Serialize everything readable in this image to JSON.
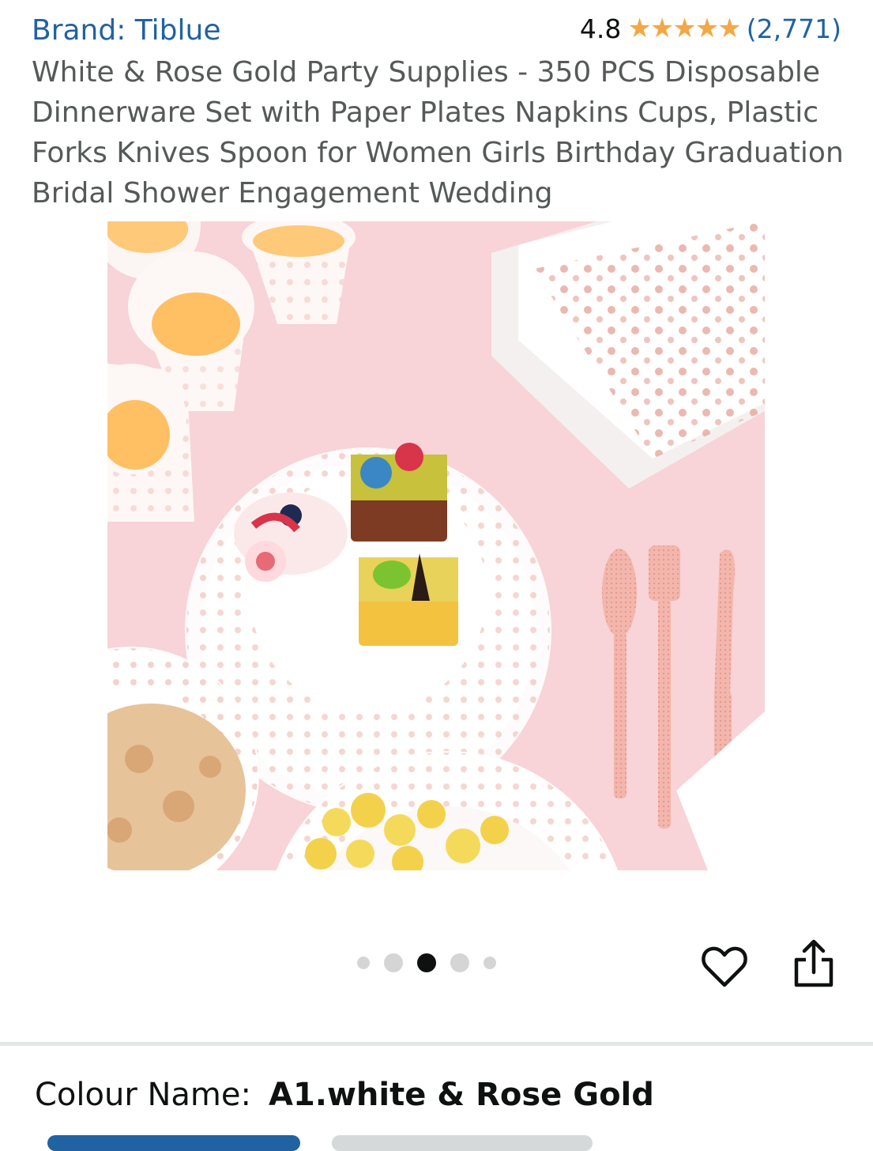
{
  "brand": "Brand: Tiblue",
  "rating": {
    "value": "4.8",
    "stars": "★★★★★",
    "count": "(2,771)"
  },
  "title": "White & Rose Gold Party Supplies - 350 PCS Disposable Dinnerware Set with Paper Plates Napkins Cups, Plastic Forks Knives Spoon for Women Girls Birthday Graduation Bridal Shower Engagement Wedding",
  "carousel": {
    "total": 5,
    "active_index": 3
  },
  "variant": {
    "label": "Colour Name:",
    "value": "A1.white & Rose Gold"
  },
  "colors": {
    "link": "#2162a1",
    "star": "#f3a847",
    "background_pink": "#f8d3d8",
    "rose_gold": "#e7a79c"
  },
  "icons": [
    "star-icon",
    "heart-icon",
    "share-icon"
  ]
}
